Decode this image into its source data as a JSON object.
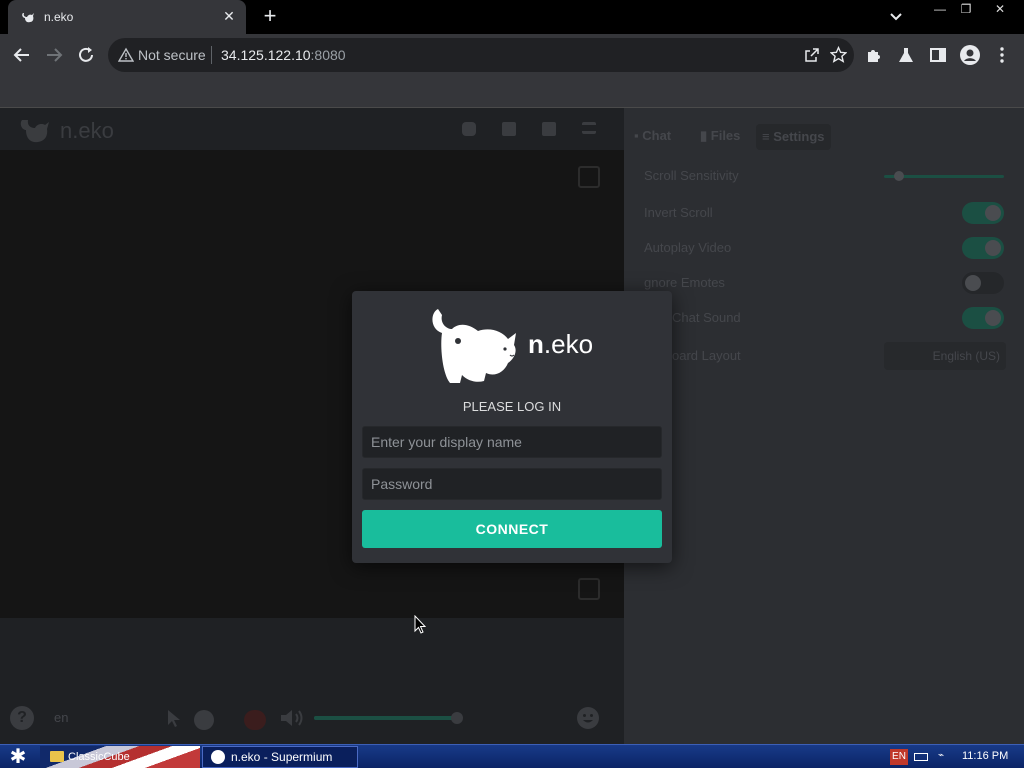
{
  "browser": {
    "tab_title": "n.eko",
    "tab_close": "✕",
    "new_tab": "+",
    "security_label": "Not secure",
    "url_host": "34.125.122.10",
    "url_port": ":8080"
  },
  "window_controls": {
    "minimize": "—",
    "restore": "❐",
    "close": "✕"
  },
  "neko": {
    "header_logo_text": "n.eko",
    "sidebar_tabs": [
      "Chat",
      "Files",
      "Settings"
    ],
    "settings": {
      "scroll_sensitivity": "Scroll Sensitivity",
      "invert_scroll": "Invert Scroll",
      "autoplay_video": "Autoplay Video",
      "ignore_emotes": "Ignore Emotes",
      "chat_sound": "Chat Sound",
      "keyboard_layout": "oard Layout",
      "keyboard_layout_value": "English (US)",
      "ignore_emotes_shown": "gnore Emotes",
      "chat_sound_shown": "Chat Sound"
    },
    "controls": {
      "language": "en",
      "help": "?"
    }
  },
  "login": {
    "brand_bold": "n",
    "brand_rest": ".eko",
    "heading": "PLEASE LOG IN",
    "display_name_placeholder": "Enter your display name",
    "password_placeholder": "Password",
    "connect_label": "CONNECT"
  },
  "taskbar": {
    "folder_label": "ClassicCube",
    "task_label": "n.eko - Supermium",
    "lang": "EN",
    "clock": "11:16 PM"
  },
  "colors": {
    "accent": "#19bd9c",
    "modal_bg": "#303237",
    "page_bg": "#202225"
  }
}
